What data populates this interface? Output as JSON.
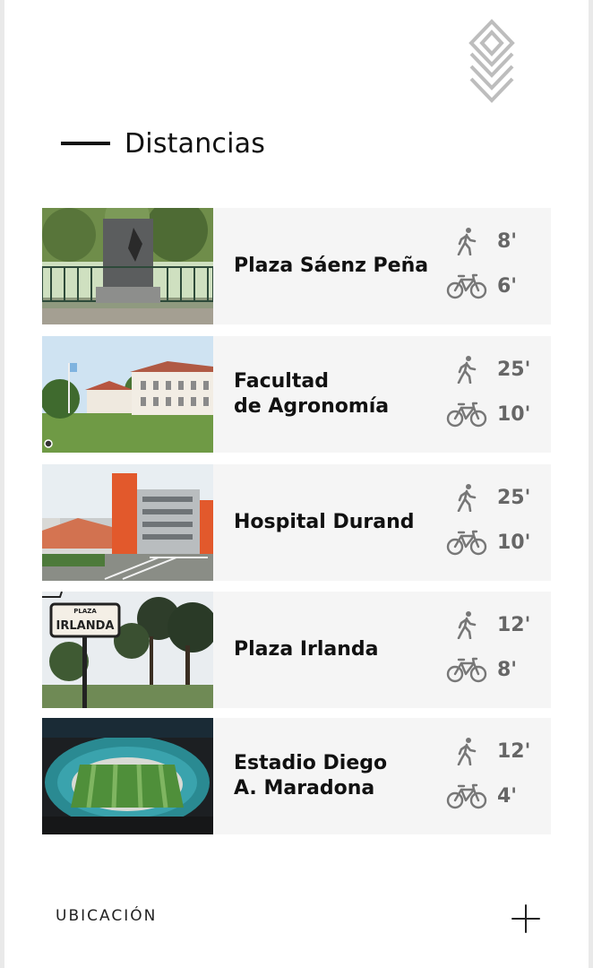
{
  "section": {
    "title": "Distancias"
  },
  "places": [
    {
      "name": "Plaza Sáenz Peña",
      "walk": "8'",
      "bike": "6'"
    },
    {
      "name": "Facultad\nde Agronomía",
      "walk": "25'",
      "bike": "10'"
    },
    {
      "name": "Hospital Durand",
      "walk": "25'",
      "bike": "10'"
    },
    {
      "name": "Plaza Irlanda",
      "walk": "12'",
      "bike": "8'"
    },
    {
      "name": "Estadio Diego\nA. Maradona",
      "walk": "12'",
      "bike": "4'"
    }
  ],
  "photo_signs": {
    "irlanda_top": "PLAZA",
    "irlanda_main": "IRLANDA"
  },
  "footer": {
    "label": "UBICACIÓN"
  },
  "icons": {
    "walk": "walking-person-icon",
    "bike": "bicycle-icon",
    "expand": "plus-icon",
    "logo": "diamond-leaf-logo"
  },
  "colors": {
    "card_bg": "#f5f5f5",
    "time_text": "#666666",
    "icon": "#777777",
    "heading_dash": "#111111"
  }
}
